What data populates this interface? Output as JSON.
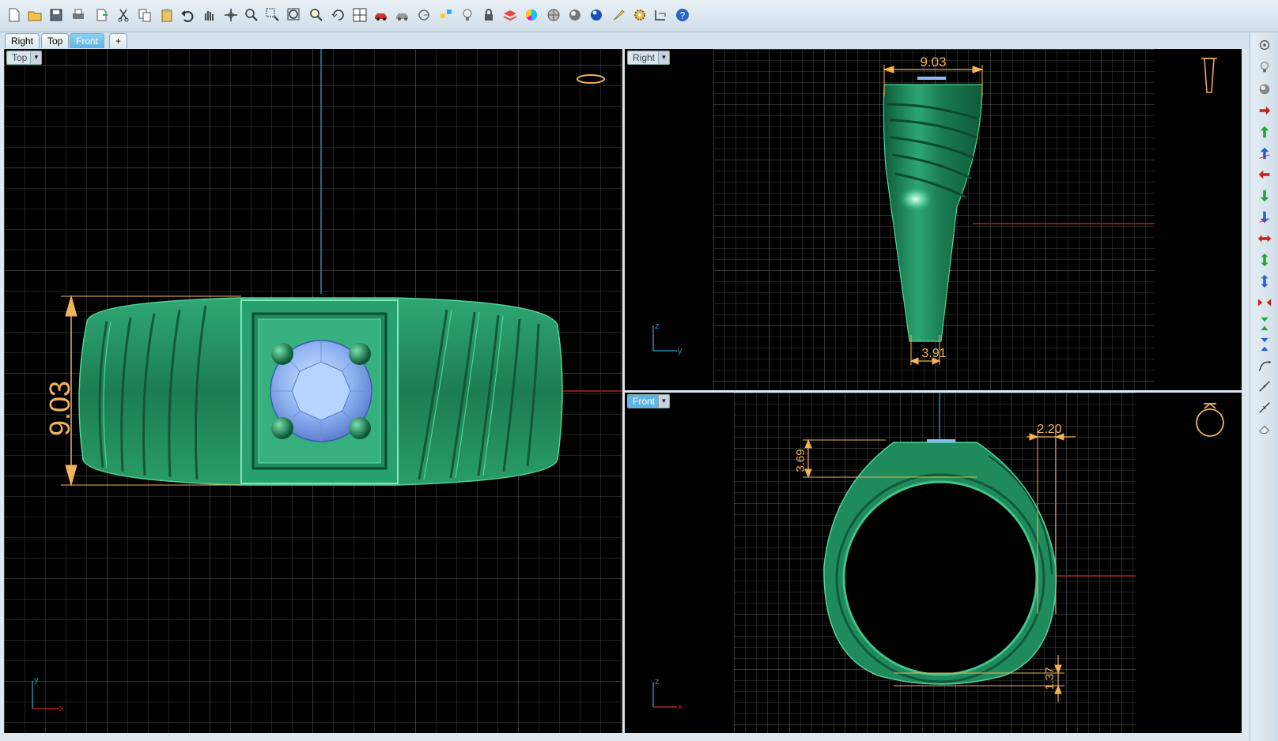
{
  "toolbar": {
    "icons": [
      "new-file-icon",
      "open-folder-icon",
      "save-icon",
      "print-icon",
      "export-icon",
      "cut-icon",
      "copy-icon",
      "paste-icon",
      "undo-icon",
      "pan-hand-icon",
      "move-icon",
      "zoom-icon",
      "zoom-window-icon",
      "zoom-extents-icon",
      "zoom-selected-icon",
      "rotate-view-icon",
      "viewport-layout-icon",
      "car-icon",
      "car-gray-icon",
      "circle-icon",
      "snap-icon",
      "light-icon",
      "lock-icon",
      "layers-icon",
      "color-wheel-icon",
      "shaded-sphere-icon",
      "render-sphere-icon",
      "blue-sphere-icon",
      "highlighter-icon",
      "gear-icon",
      "dimension-icon",
      "help-icon"
    ]
  },
  "tabs": [
    {
      "label": "Right",
      "active": false
    },
    {
      "label": "Top",
      "active": false
    },
    {
      "label": "Front",
      "active": true
    },
    {
      "label": "+",
      "active": false
    }
  ],
  "viewports": {
    "top": {
      "label": "Top",
      "dimension": "9.03",
      "axis_a": "y",
      "axis_b": "x"
    },
    "right": {
      "label": "Right",
      "dim_top": "9.03",
      "dim_bottom": "3.91",
      "axis_a": "z",
      "axis_b": "y"
    },
    "front": {
      "label": "Front",
      "dim_left": "3.69",
      "dim_right": "2.20",
      "dim_bottom": "1.37",
      "axis_a": "z",
      "axis_b": "x"
    }
  },
  "sidebar": {
    "icons": [
      "camera-icon",
      "light-bulb-icon",
      "sphere-icon",
      "arrow-right-red-icon",
      "arrow-up-green-icon",
      "arrow-up-blue-icon",
      "arrow-left-red-icon",
      "arrow-down-green-icon",
      "arrow-down-blue-icon",
      "arrows-horizontal-red-icon",
      "arrows-vertical-green-icon",
      "arrows-vertical-blue-icon",
      "arrows-in-red-icon",
      "arrows-in-green-icon",
      "arrows-in-blue-icon",
      "curve-tool-icon",
      "line-tool-icon",
      "line-tool-2-icon",
      "eraser-icon"
    ]
  },
  "colors": {
    "ring": "#1f8a5c",
    "gem": "#8fb9f5",
    "dimension": "#f3b35b",
    "grid": "#4a4a4a",
    "axis_red": "#b02020",
    "axis_blue": "#2a88a8"
  }
}
